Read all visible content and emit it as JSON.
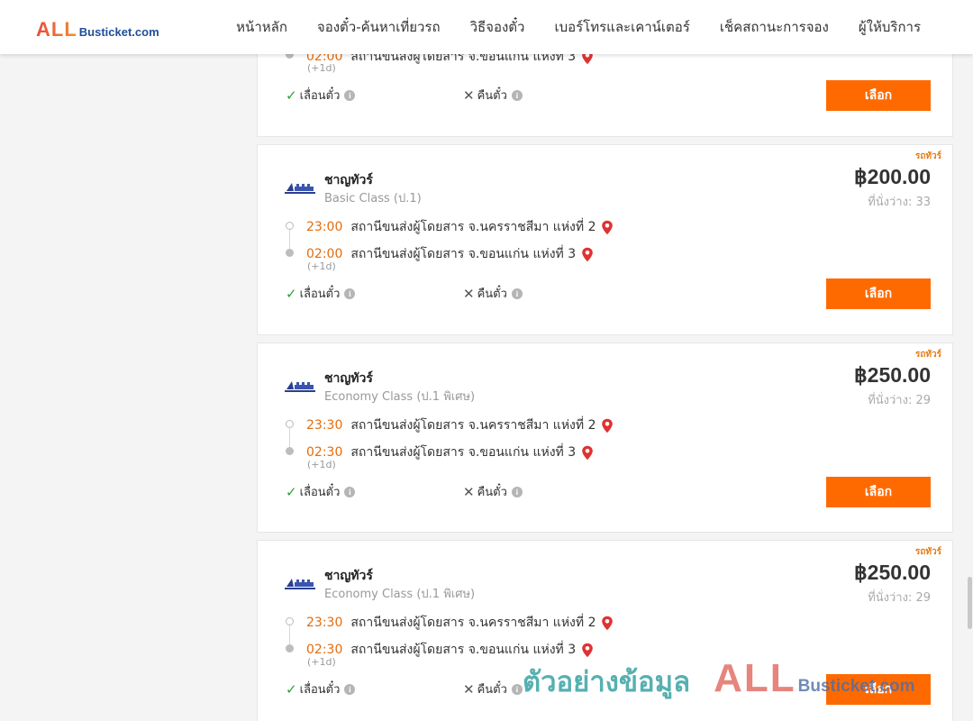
{
  "header": {
    "logo": {
      "all": "ALL",
      "rest": "Busticket.com"
    },
    "nav": [
      "หน้าหลัก",
      "จองตั๋ว-ค้นหาเที่ยวรถ",
      "วิธีจองตั๋ว",
      "เบอร์โทรและเคาน์เตอร์",
      "เช็คสถานะการจอง",
      "ผู้ให้บริการ"
    ]
  },
  "partial_card": {
    "arrival_time": "02:00",
    "arrival_place": "สถานีขนส่งผู้โดยสาร จ.ขอนแก่น แห่งที่ 3",
    "next_day": "(+1d)",
    "move_label": "เลื่อนตั๋ว",
    "refund_label": "คืนตั๋ว",
    "button": "เลือก"
  },
  "trips": [
    {
      "tag": "รถทัวร์",
      "operator": "ชาญทัวร์",
      "bus_class": "Basic Class (ป.1)",
      "price": "฿200.00",
      "seats": "ที่นั่งว่าง: 33",
      "depart_time": "23:00",
      "depart_place": "สถานีขนส่งผู้โดยสาร จ.นครราชสีมา แห่งที่ 2",
      "arrive_time": "02:00",
      "arrive_place": "สถานีขนส่งผู้โดยสาร จ.ขอนแก่น แห่งที่ 3",
      "next_day": "(+1d)",
      "move_label": "เลื่อนตั๋ว",
      "refund_label": "คืนตั๋ว",
      "button": "เลือก"
    },
    {
      "tag": "รถทัวร์",
      "operator": "ชาญทัวร์",
      "bus_class": "Economy Class (ป.1 พิเศษ)",
      "price": "฿250.00",
      "seats": "ที่นั่งว่าง: 29",
      "depart_time": "23:30",
      "depart_place": "สถานีขนส่งผู้โดยสาร จ.นครราชสีมา แห่งที่ 2",
      "arrive_time": "02:30",
      "arrive_place": "สถานีขนส่งผู้โดยสาร จ.ขอนแก่น แห่งที่ 3",
      "next_day": "(+1d)",
      "move_label": "เลื่อนตั๋ว",
      "refund_label": "คืนตั๋ว",
      "button": "เลือก"
    },
    {
      "tag": "รถทัวร์",
      "operator": "ชาญทัวร์",
      "bus_class": "Economy Class (ป.1 พิเศษ)",
      "price": "฿250.00",
      "seats": "ที่นั่งว่าง: 29",
      "depart_time": "23:30",
      "depart_place": "สถานีขนส่งผู้โดยสาร จ.นครราชสีมา แห่งที่ 2",
      "arrive_time": "02:30",
      "arrive_place": "สถานีขนส่งผู้โดยสาร จ.ขอนแก่น แห่งที่ 3",
      "next_day": "(+1d)",
      "move_label": "เลื่อนตั๋ว",
      "refund_label": "คืนตั๋ว",
      "button": "เลือก"
    }
  ],
  "watermark": {
    "thai": "ตัวอย่างข้อมูล",
    "all": "ALL",
    "rest": "Busticket.com"
  },
  "icons": {
    "pin": "map-pin-icon",
    "check": "check-icon",
    "cross": "cross-icon",
    "info": "info-icon"
  },
  "colors": {
    "accent": "#ff6a00",
    "time": "#e66b0a",
    "check": "#2e9e3c",
    "pin": "#e03232"
  }
}
